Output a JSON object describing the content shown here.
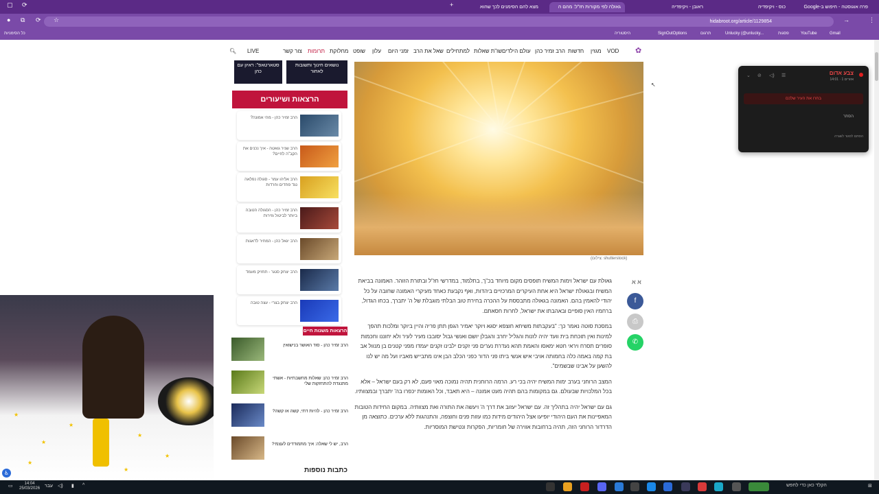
{
  "browser": {
    "tabs": [
      {
        "label": "פרה אוגוסטה - חיפוש ב-Google"
      },
      {
        "label": "כוס - ויקיפדיה"
      },
      {
        "label": "ראובן - ויקיפדיה"
      },
      {
        "label": "גאולה לפי מקורות חז\"ל: מהם ה"
      },
      {
        "label": "מצא להם הסימנים לכך שהוא"
      }
    ],
    "url": "hidabroot.org/article/1129854",
    "bookmarks": [
      "כל הסימניות",
      "היסטוריה",
      "SignOutOptions",
      "תרגום",
      "Unlucky (@unlucky...",
      "YouTube",
      "פסגות",
      "Gmail"
    ]
  },
  "site": {
    "nav": [
      "VOD",
      "מגזין",
      "חדשות",
      "הרב זמיר כהן",
      "עולם הילדים",
      "שו\"ת שאלות",
      "למתחילים",
      "שאל את הרב",
      "זמני היום",
      "עלון",
      "שופט",
      "מחלוקת",
      "תרומות",
      "צור קשר",
      "LIVE"
    ],
    "mini_cards": [
      "סטארטאפ\": ראיון עם כהן",
      "נושאים חינוך ותשובות לאחור"
    ],
    "lectures_title": "הרצאות ושיעורים",
    "lectures": [
      "הרב זמיר כהן - מהי אמונה?",
      "הרב שניר גואטה - איך נכנים את הקב\"ה לחיים?",
      "הרב אליהו עמר - סגולה נפלאה נגד פחדים וחרדות",
      "הרב זמיר כהן - הסגולה הטובה ביותר לביטול גזירות",
      "הרב יגאל כהן - המחיר לדאגות",
      "הרב יצחק סנגר - תחזיק מעמד",
      "הרב יצחק בצרי - עצה טובה"
    ],
    "lives_badge": "הרצאות משנות חיים",
    "lives": [
      "הרב זמיר כהן - סוד האושר בנישואין",
      "הרב זמיר כהן: שאלות מחשבתיות - אשתי מתנגדת להתחזקות שלי",
      "הרב זמיר כהן - להיות דתי, קשה או קשה?",
      "הרב, יש לי שאלה: איך מתמודדים לעצמי?"
    ],
    "more_articles": "כתבות נוספות",
    "image_credit": "(צילום: shutterstock)",
    "font_toggle": "א א",
    "article": [
      "גאולת עם ישראל וימות המשיח תופסים מקום מיוחד בכ\"ך, בתלמוד, במדרשי חז\"ל ובתורת הזוהר. האמונה בביאת המשיח ובגאולת ישראל היא אחת העיקרים המרכזיים ביהדות, ואף נקבעת כאחד מעיקרי האמונה שחובה על כל יהודי להאמין בהם. האמונה בגאולה מתבססת על ההכרה בחירת טוב הבלתי מוגבלת של ה' יתברך, בכחו הגדול, ברחמיו האין סופיים ובאהבתו את ישראל, לחרות חסאתם.",
      "במסכת סוטה נאמר כך: \"בעקבתות משיחא חוצפא יסגא ויוקר יאמיר הגפן תתן פריה והיין ביוקר ומלכות תהפך למינות ואין תוכחת בית וועד יהיה לזנות והגליל יחרב והגבלן יושם ואנשי גבול יסובבו מעיר לעיר ולא יחוננו וחכמות סופרים תסרח ויראי חטא ימאסו והאמת תהא נעדרת נערים פני זקנים ילבינו זקנים יעמדו מפני קטנים בן מנוול אב בת קמה באמה כלה בחמותה אויבי איש אנשי ביתו פני הדור כפני הכלב הבן אינו מתבייש מאביו ועל מה יש לנו להשען על אבינו שבשמים\".",
      "המצב הרוחני בערב ימות המשיח יהיה בכי רע. הרמה הרוחנית תהיה נמוכה מאוי פעם, לא רק בעם ישראל – אלא בכל המלכויות שבעולם. גם במקומות בהם תהיה מעט אמונה – היא תאבד, וכל האומות יכפרו בה' יתברך ובמצוותיו.",
      "גם עם ישראל יהיה בתהליך זה. עם ישראל יעזוב את דרך ה' ויעשה את התורה ואת מצוותיה. במקום החידות הטובות המאפיינות את העם היהודי יופיעו אצל היהודים מידות כמו עזות פנים וחוצפה, והתנהגות ללא ערכים. כתוצאה מן הדרדור הרוחני הזה, תהיה ברחובות אווירה של חומריות, הפקרות ונטישת המוסריות."
    ],
    "article_link": "ימות המשיח"
  },
  "popup": {
    "title": "צבע אדום",
    "subtitle": "14:01 · 1 אזורים",
    "alert": "בחרו את העיר שלכם",
    "close": "הסתר",
    "footer": "הסתם לסגור לשגרה"
  },
  "taskbar": {
    "time": "14:04",
    "date": "25/03/2026",
    "lang": "עבר",
    "search": "הקלד כאן כדי לחפש"
  },
  "colors": {
    "browser_frame": "#7a4aa8",
    "site_red": "#c0143c",
    "facebook": "#3b5998",
    "whatsapp": "#25d366"
  }
}
